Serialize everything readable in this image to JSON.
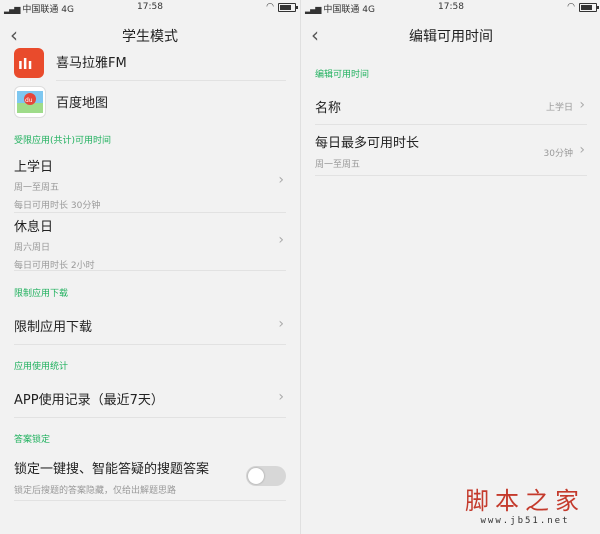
{
  "status": {
    "carrier": "中国联通",
    "network": "4G",
    "time": "17:58"
  },
  "left": {
    "title": "学生模式",
    "apps": [
      {
        "label": "喜马拉雅FM",
        "icon": "ximalaya-icon",
        "color": "#e94b2c"
      },
      {
        "label": "百度地图",
        "icon": "baidu-map-icon",
        "color": "#3c8cf5"
      }
    ],
    "shared_section": "受限应用(共计)可用时间",
    "schoolday": {
      "label": "上学日",
      "days": "周一至周五",
      "duration": "每日可用时长 30分钟"
    },
    "weekend": {
      "label": "休息日",
      "days": "周六周日",
      "duration": "每日可用时长 2小时"
    },
    "download_section": "限制应用下载",
    "download_item": "限制应用下载",
    "stats_section": "应用使用统计",
    "stats_item": "APP使用记录（最近7天）",
    "answer_section": "答案锁定",
    "answer_item": "锁定一键搜、智能答疑的搜题答案",
    "answer_sub": "锁定后搜题的答案隐藏，仅给出解题思路"
  },
  "right": {
    "title": "编辑可用时间",
    "section": "编辑可用时间",
    "name_label": "名称",
    "name_value": "上学日",
    "max_label": "每日最多可用时长",
    "max_sub": "周一至周五",
    "max_value": "30分钟"
  },
  "watermark": {
    "main": "脚本之家",
    "url": "www.jb51.net"
  },
  "colors": {
    "accent": "#21b15f",
    "watermark": "#c43a2c"
  }
}
